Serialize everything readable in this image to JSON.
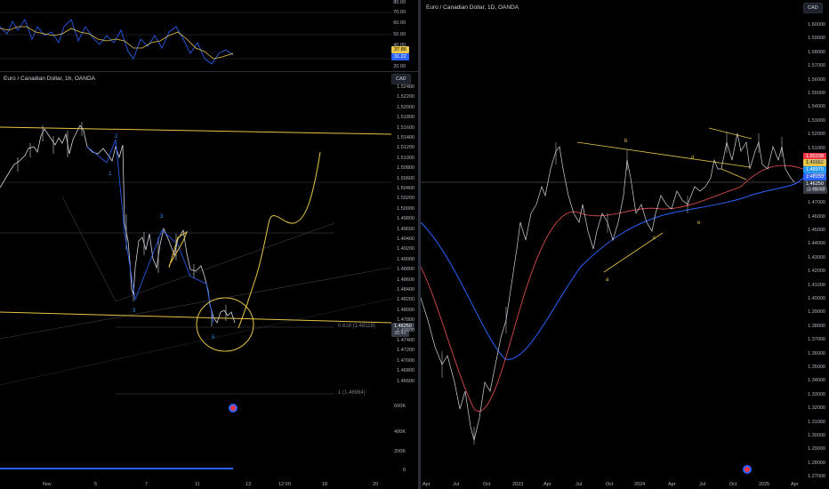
{
  "left_top": {
    "y_ticks": [
      "80.00",
      "70.00",
      "60.00",
      "50.00",
      "40.00",
      "30.00",
      "20.00"
    ],
    "badge_1": "37.86",
    "badge_2": "31.22"
  },
  "left_main": {
    "title": "Euro / Canadian Dollar, 1h, OANDA",
    "currency_button": "CAD",
    "y_ticks": [
      "1.52400",
      "1.52200",
      "1.52000",
      "1.51800",
      "1.51600",
      "1.51400",
      "1.51200",
      "1.51000",
      "1.50800",
      "1.50600",
      "1.50400",
      "1.50200",
      "1.50000",
      "1.49800",
      "1.49600",
      "1.49400",
      "1.49200",
      "1.49000",
      "1.48800",
      "1.48600",
      "1.48400",
      "1.48200",
      "1.48000",
      "1.47800",
      "1.47600",
      "1.47400",
      "1.47200",
      "1.47000",
      "1.46800",
      "1.46600"
    ],
    "price_label": "1.46250",
    "price_sub": "36:42",
    "fib_1": "0.618 (1.48118)",
    "fib_2": "1 (1.46964)",
    "wave_labels": [
      "1",
      "2",
      "3",
      "4",
      "3",
      "5"
    ],
    "volume_ticks": [
      "600K",
      "400K",
      "200K",
      "0"
    ],
    "x_ticks": [
      "Nov",
      "5",
      "7",
      "11",
      "13",
      "12:00",
      "18",
      "20"
    ]
  },
  "right": {
    "title": "Euro / Canadian Dollar, 1D, OANDA",
    "currency_button": "CAD",
    "y_ticks": [
      "1.60000",
      "1.59000",
      "1.58000",
      "1.57000",
      "1.56000",
      "1.55000",
      "1.54000",
      "1.53000",
      "1.52000",
      "1.51000",
      "1.50000",
      "1.49000",
      "1.48000",
      "1.47000",
      "1.46000",
      "1.45000",
      "1.44000",
      "1.43000",
      "1.42000",
      "1.41000",
      "1.40000",
      "1.39000",
      "1.38000",
      "1.37000",
      "1.36000",
      "1.35000",
      "1.34000",
      "1.33000",
      "1.32000",
      "1.31000",
      "1.30000",
      "1.29000",
      "1.28000",
      "1.27000"
    ],
    "price_labels": [
      "1.50108",
      "1.49882",
      "1.48979",
      "1.48153",
      "1.46250"
    ],
    "price_time": "12:36:42",
    "wave_labels": [
      "a",
      "b",
      "c",
      "d",
      "e"
    ],
    "x_ticks": [
      "Apr",
      "Jul",
      "Oct",
      "2023",
      "Apr",
      "Jul",
      "Oct",
      "2024",
      "Apr",
      "Jul",
      "Oct",
      "2025",
      "Apr"
    ]
  },
  "colors": {
    "accent_yellow": "#e8c547",
    "blue_ma": "#2962ff",
    "red_ma": "#ef5350",
    "price_red": "#f23645",
    "price_blue": "#2196f3",
    "grey": "#787b86"
  }
}
